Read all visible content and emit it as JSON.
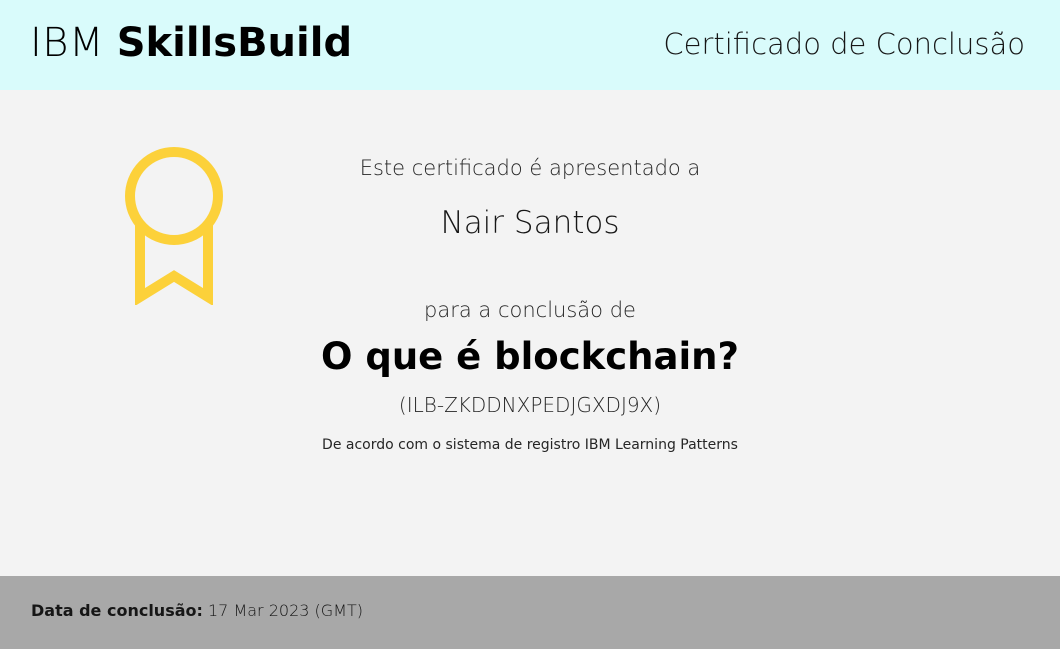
{
  "header": {
    "brand_prefix": "IBM",
    "brand_name": "SkillsBuild",
    "title": "Certificado de Conclusão",
    "background_color": "#d9fbfb"
  },
  "badge": {
    "icon": "award-ribbon-icon",
    "color": "#fcd13a"
  },
  "certificate": {
    "presented_to_label": "Este certificado é apresentado a",
    "recipient_name": "Nair Santos",
    "completion_label": "para a conclusão de",
    "course_title": "O que é blockchain?",
    "course_id": "(ILB-ZKDDNXPEDJGXDJ9X)",
    "registry_note": "De acordo com o sistema de registro IBM Learning Patterns"
  },
  "footer": {
    "date_label": "Data de conclusão:",
    "date_value": "17 Mar 2023 (GMT)",
    "background_color": "#a8a8a8"
  }
}
